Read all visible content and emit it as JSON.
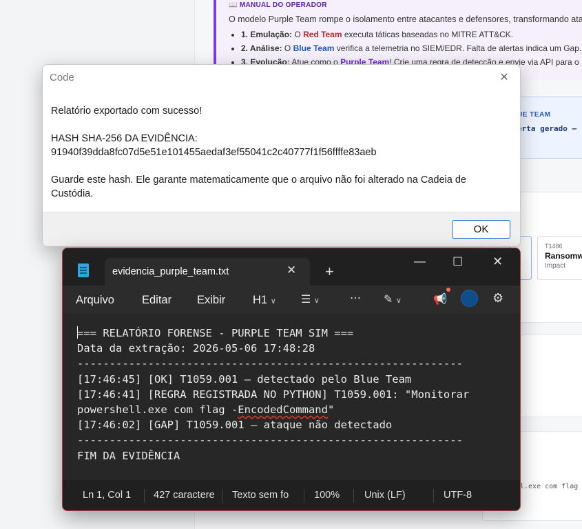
{
  "background": {
    "manual": {
      "heading": "MANUAL DO OPERADOR",
      "intro": "O modelo Purple Team rompe o isolamento entre atacantes e defensores, transformando atac",
      "items": [
        {
          "label": "1. Emulação:",
          "pre": "O",
          "team": "Red Team",
          "post": "executa táticas baseadas no MITRE ATT&CK."
        },
        {
          "label": "2. Análise:",
          "pre": "O",
          "team": "Blue Team",
          "post": "verifica a telemetria no SIEM/EDR. Falta de alertas indica um Gap."
        },
        {
          "label": "3. Evolução:",
          "pre": "Atue como o",
          "team": "Purple Team",
          "post": "! Crie uma regra de detecção e envie via API para o"
        }
      ]
    },
    "blue_card": {
      "title": "UE TEAM",
      "message": "erta gerado —"
    },
    "tactic_card": {
      "id": "T1486",
      "name": "Ransomw",
      "phase": "Impact"
    },
    "log_fragment": "l.exe com flag"
  },
  "dialog": {
    "title": "Code",
    "line1": "Relatório exportado com sucesso!",
    "hash_label": "HASH SHA-256 DA EVIDÊNCIA:",
    "hash_value": "91940f39dda8fc07d5e51e101455aedaf3ef55041c2c40777f1f56ffffe83aeb",
    "note": "Guarde este hash. Ele garante matematicamente que o arquivo não foi alterado na Cadeia de Custódia.",
    "ok_label": "OK"
  },
  "notepad": {
    "tab_title": "evidencia_purple_team.txt",
    "menu": {
      "file": "Arquivo",
      "edit": "Editar",
      "view": "Exibir",
      "heading": "H1"
    },
    "content": {
      "header_rest": "=== RELATÓRIO FORENSE - PURPLE TEAM SIM ===",
      "date_line": "Data da extração: 2026-05-06 17:48:28",
      "separator": "------------------------------------------------------------",
      "log1": "[17:46:45] [OK] T1059.001 — detectado pelo Blue Team",
      "log2a": "[17:46:41] [REGRA REGISTRADA NO PYTHON] T1059.001: \"Monitorar",
      "log2b_pre": "powershell.exe com flag -",
      "log2b_word": "EncodedCommand",
      "log2b_post": "\"",
      "log3": "[17:46:02] [GAP] T1059.001 — ataque não detectado",
      "footer": "FIM DA EVIDÊNCIA"
    },
    "status": {
      "position": "Ln 1, Col 1",
      "count": "427 caractere",
      "format": "Texto sem fo",
      "zoom": "100%",
      "line_ending": "Unix (LF)",
      "encoding": "UTF-8"
    }
  },
  "colors": {
    "accent": "#1e6fd9",
    "red_team": "#c0262d",
    "blue_team": "#1f57b8",
    "purple_team": "#6d28d9"
  }
}
